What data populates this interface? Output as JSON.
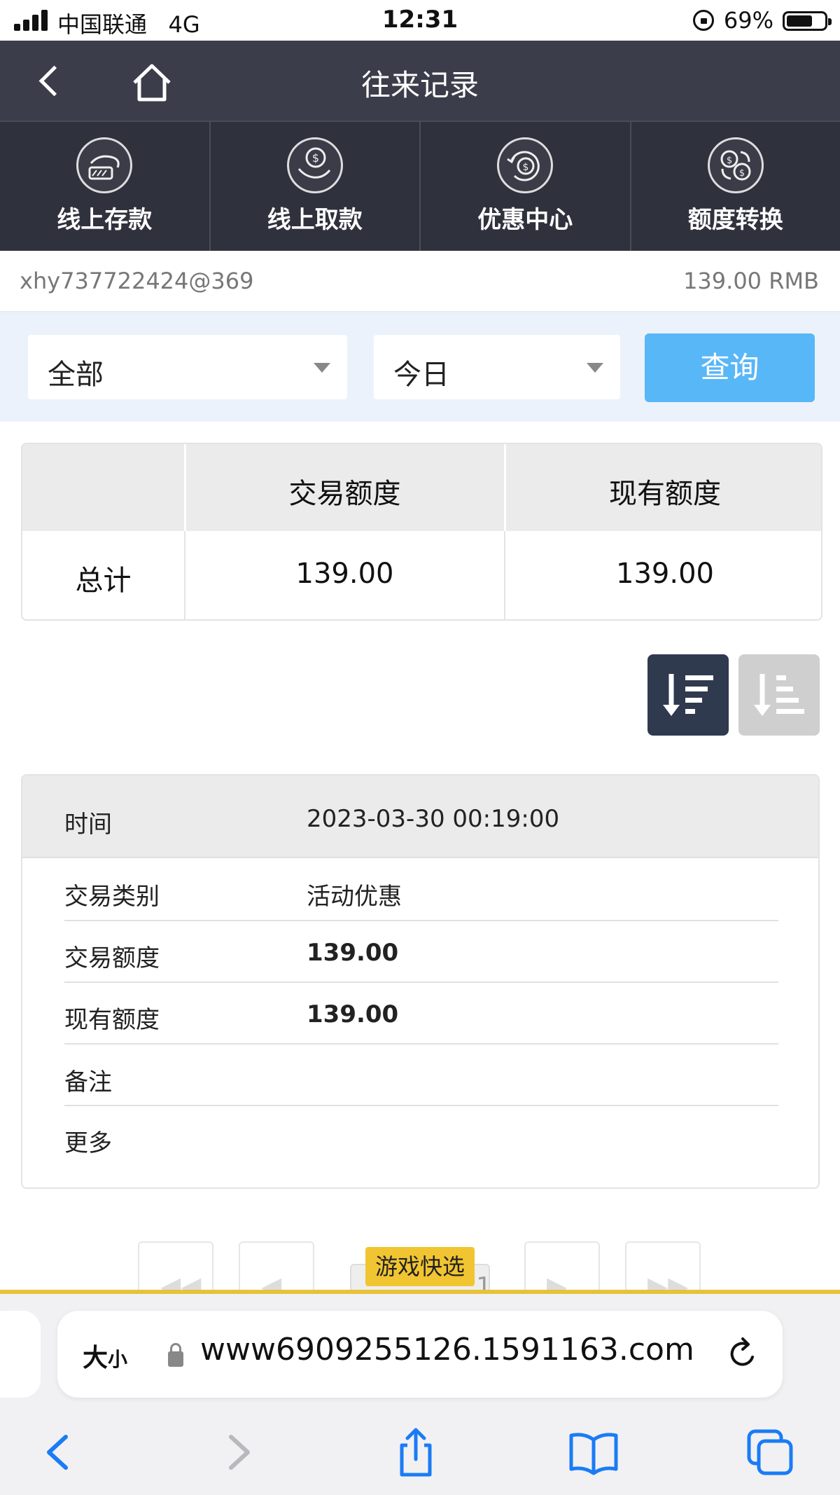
{
  "status_bar": {
    "carrier": "中国联通",
    "network": "4G",
    "time": "12:31",
    "battery": "69%",
    "battery_level": 0.69
  },
  "header": {
    "title": "往来记录"
  },
  "nav": {
    "items": [
      {
        "label": "线上存款",
        "icon": "deposit-icon"
      },
      {
        "label": "线上取款",
        "icon": "withdraw-icon"
      },
      {
        "label": "优惠中心",
        "icon": "promotion-icon"
      },
      {
        "label": "额度转换",
        "icon": "transfer-icon"
      }
    ]
  },
  "account": {
    "username": "xhy737722424@369",
    "balance": "139.00 RMB"
  },
  "filter": {
    "type_selected": "全部",
    "period_selected": "今日",
    "query_label": "查询"
  },
  "summary": {
    "headers": [
      "",
      "交易额度",
      "现有额度"
    ],
    "row": {
      "label": "总计",
      "trade_amount": "139.00",
      "current_amount": "139.00"
    }
  },
  "record": {
    "time_label": "时间",
    "time_value": "2023-03-30 00:19:00",
    "rows": [
      {
        "label": "交易类别",
        "value": "活动优惠"
      },
      {
        "label": "交易额度",
        "value": "139.00"
      },
      {
        "label": "现有额度",
        "value": "139.00"
      },
      {
        "label": "备注",
        "value": ""
      },
      {
        "label": "更多",
        "value": ""
      }
    ]
  },
  "pagination": {
    "current_page": "1",
    "floating_button": "游戏快选"
  },
  "browser": {
    "text_size_label": "大",
    "text_size_small": "小",
    "url": "www6909255126.1591163.com"
  },
  "colors": {
    "header_bg": "#3b3d4a",
    "nav_bg": "#2f313d",
    "query_button": "#58b7f7",
    "filter_bg": "#ecf2fb",
    "sort_active": "#2f3a4f",
    "accent_yellow": "#f1c532",
    "ios_blue": "#1a7cf5"
  }
}
